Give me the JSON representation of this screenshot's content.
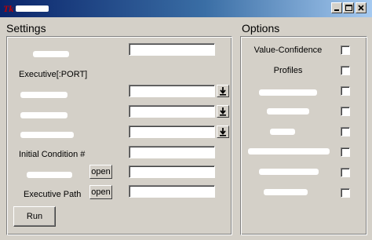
{
  "window": {
    "title": "",
    "icon": "tk-feather-icon",
    "controls": {
      "minimize": "minimize-icon",
      "maximize": "maximize-icon",
      "close": "close-icon"
    }
  },
  "settings": {
    "title": "Settings",
    "rows": [
      {
        "label": "",
        "value": "",
        "has_download": false
      },
      {
        "label": "Executive[:PORT]"
      },
      {
        "label": "",
        "value": "",
        "has_download": true
      },
      {
        "label": "",
        "value": "",
        "has_download": true
      },
      {
        "label": "",
        "value": "",
        "has_download": true
      },
      {
        "label": "Initial Condition #",
        "value": ""
      },
      {
        "label": "",
        "button": "open",
        "value": ""
      },
      {
        "label": "Executive Path",
        "button": "open",
        "value": ""
      }
    ],
    "run_label": "Run"
  },
  "options": {
    "title": "Options",
    "items": [
      {
        "label": "Value-Confidence",
        "checked": false
      },
      {
        "label": "Profiles",
        "checked": false
      },
      {
        "label": "",
        "checked": false
      },
      {
        "label": "",
        "checked": false
      },
      {
        "label": "",
        "checked": false
      },
      {
        "label": "",
        "checked": false
      },
      {
        "label": "",
        "checked": false
      },
      {
        "label": "",
        "checked": false
      }
    ]
  }
}
